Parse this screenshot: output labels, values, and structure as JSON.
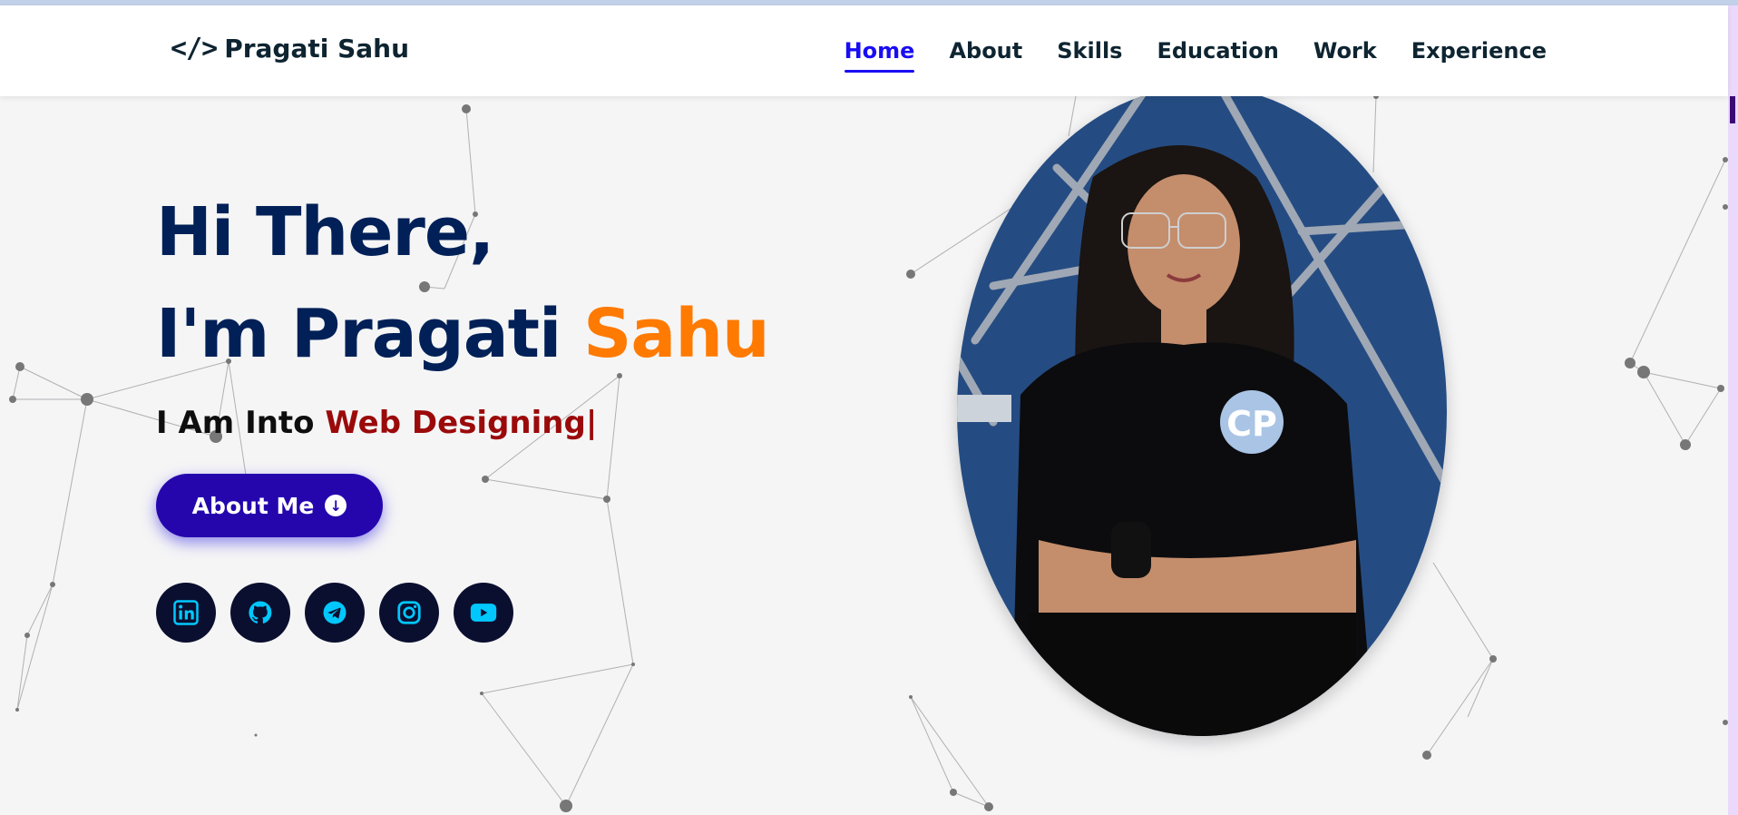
{
  "brand": {
    "logo_symbol": "</>",
    "name": "Pragati Sahu"
  },
  "nav": {
    "items": [
      {
        "label": "Home",
        "active": true
      },
      {
        "label": "About",
        "active": false
      },
      {
        "label": "Skills",
        "active": false
      },
      {
        "label": "Education",
        "active": false
      },
      {
        "label": "Work",
        "active": false
      },
      {
        "label": "Experience",
        "active": false
      }
    ]
  },
  "hero": {
    "greeting": "Hi There,",
    "intro_prefix": "I'm Pragati",
    "intro_highlight": "Sahu",
    "typed_prefix": "I Am Into",
    "typed_role": "Web Designing|",
    "about_button": "About Me"
  },
  "socials": [
    {
      "name": "LinkedIn",
      "icon": "linkedin-icon"
    },
    {
      "name": "GitHub",
      "icon": "github-icon"
    },
    {
      "name": "Telegram",
      "icon": "telegram-icon"
    },
    {
      "name": "Instagram",
      "icon": "instagram-icon"
    },
    {
      "name": "YouTube",
      "icon": "youtube-icon"
    }
  ],
  "colors": {
    "heading": "#002057",
    "accent": "#ff7a00",
    "role": "#9b0a0a",
    "nav_active": "#1a0df2",
    "button": "#2506ad",
    "social_bg": "#0b0f2f",
    "social_icon": "#00c8ff"
  }
}
